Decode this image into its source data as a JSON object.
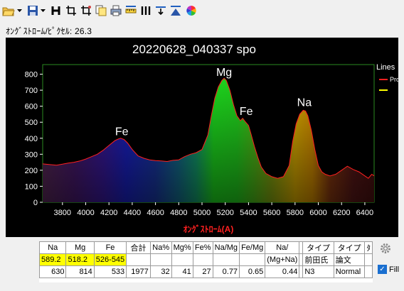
{
  "status_text": "ｵﾝｸﾞｽﾄﾛｰﾑ/ﾋﾟｸｾﾙ: 26.3",
  "chart_data": {
    "type": "line",
    "title": "20220628_040337 spo",
    "xlabel": "ｵﾝｸﾞｽﾄﾛｰﾑ(A)",
    "ylabel": "",
    "xlim": [
      3630,
      6480
    ],
    "ylim": [
      0,
      860
    ],
    "x_ticks": [
      3800,
      4000,
      4200,
      4400,
      4600,
      4800,
      5000,
      5200,
      5400,
      5600,
      5800,
      6000,
      6200,
      6400
    ],
    "y_ticks": [
      0,
      100,
      200,
      300,
      400,
      500,
      600,
      700,
      800
    ],
    "legend": {
      "title": "Lines",
      "placement": "right",
      "entries": [
        "Pro",
        ""
      ],
      "colors": [
        "#ff2020",
        "#ffff00"
      ]
    },
    "series": [
      {
        "name": "Pro",
        "color": "#ff2020",
        "x": [
          3630,
          3700,
          3750,
          3800,
          3850,
          3900,
          3950,
          4000,
          4050,
          4100,
          4150,
          4200,
          4250,
          4280,
          4300,
          4330,
          4360,
          4400,
          4450,
          4500,
          4550,
          4600,
          4650,
          4700,
          4750,
          4800,
          4850,
          4900,
          4950,
          5000,
          5050,
          5080,
          5110,
          5140,
          5170,
          5190,
          5210,
          5240,
          5270,
          5300,
          5330,
          5350,
          5370,
          5400,
          5420,
          5450,
          5480,
          5510,
          5550,
          5600,
          5650,
          5700,
          5750,
          5780,
          5810,
          5840,
          5870,
          5890,
          5910,
          5940,
          5970,
          6000,
          6030,
          6060,
          6100,
          6150,
          6200,
          6250,
          6300,
          6350,
          6400,
          6430,
          6460,
          6480
        ],
        "y": [
          240,
          235,
          232,
          238,
          245,
          250,
          258,
          270,
          285,
          300,
          325,
          355,
          385,
          395,
          400,
          392,
          370,
          330,
          290,
          275,
          265,
          260,
          258,
          255,
          262,
          265,
          285,
          300,
          310,
          330,
          420,
          540,
          650,
          720,
          760,
          775,
          760,
          700,
          610,
          540,
          510,
          525,
          505,
          480,
          430,
          350,
          280,
          220,
          180,
          160,
          150,
          160,
          230,
          380,
          490,
          550,
          575,
          570,
          540,
          450,
          330,
          230,
          190,
          175,
          165,
          175,
          200,
          225,
          205,
          190,
          165,
          150,
          175,
          165
        ]
      }
    ],
    "annotations": [
      {
        "text": "Fe",
        "x": 4310,
        "y": 420
      },
      {
        "text": "Mg",
        "x": 5190,
        "y": 790
      },
      {
        "text": "Fe",
        "x": 5380,
        "y": 545
      },
      {
        "text": "Na",
        "x": 5880,
        "y": 600
      }
    ]
  },
  "table": {
    "headers": [
      "Na",
      "Mg",
      "Fe",
      "合計",
      "Na%",
      "Mg%",
      "Fe%",
      "Na/Mg",
      "Fe/Mg",
      "Na/",
      "",
      "タイプ",
      "タイプ",
      "ﾀ"
    ],
    "row1": [
      "589.2",
      "518.2",
      "526-545",
      "",
      "",
      "",
      "",
      "",
      "",
      "(Mg+Na)",
      "",
      "前田氏",
      "論文",
      ""
    ],
    "row2": [
      "630",
      "814",
      "533",
      "1977",
      "32",
      "41",
      "27",
      "0.77",
      "0.65",
      "0.44",
      "",
      "N3",
      "Normal",
      ""
    ]
  },
  "fill_label": "Fill",
  "icons": [
    "open-folder-icon",
    "save-icon",
    "header-icon",
    "crop-icon",
    "copy-icon",
    "print-icon",
    "ruler-icon",
    "columns-icon",
    "subtract-icon",
    "mountain-icon",
    "color-wheel-icon",
    "gear-icon"
  ]
}
